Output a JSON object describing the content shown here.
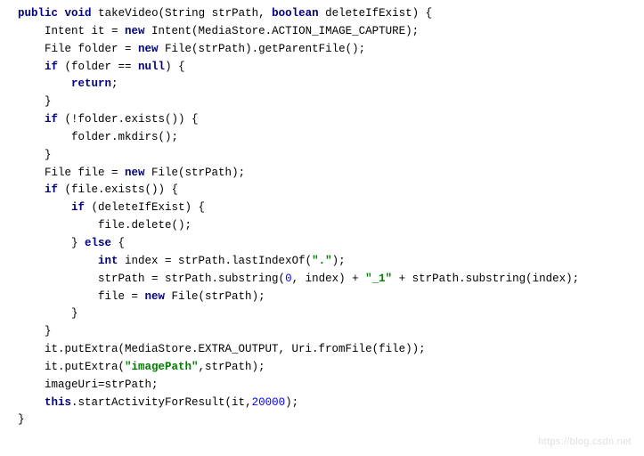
{
  "code": {
    "kw": {
      "public": "public",
      "void": "void",
      "boolean": "boolean",
      "new": "new",
      "if": "if",
      "null": "null",
      "return": "return",
      "else": "else",
      "int": "int",
      "this": "this"
    },
    "id": {
      "takeVideo": "takeVideo",
      "strPath_sig": "(String strPath, ",
      "deleteIfExist_decl": " deleteIfExist) {",
      "l2a": "    Intent it = ",
      "l2b": " Intent(MediaStore.ACTION_IMAGE_CAPTURE);",
      "l3a": "    File folder = ",
      "l3b": " File(strPath).getParentFile();",
      "l4a": "    ",
      "l4b": " (folder == ",
      "l4c": ") {",
      "l5a": "        ",
      "l5b": ";",
      "l6": "    }",
      "l7a": "    ",
      "l7b": " (!folder.exists()) {",
      "l8": "        folder.mkdirs();",
      "l9": "    }",
      "l10a": "    File file = ",
      "l10b": " File(strPath);",
      "l11a": "    ",
      "l11b": " (file.exists()) {",
      "l12a": "        ",
      "l12b": " (deleteIfExist) {",
      "l13": "            file.delete();",
      "l14a": "        } ",
      "l14b": " {",
      "l15a": "            ",
      "l15b": " index = strPath.lastIndexOf(",
      "l15c": ");",
      "l16a": "            strPath = strPath.substring(",
      "l16b": ", index) + ",
      "l16c": " + strPath.substring(index);",
      "l17a": "            file = ",
      "l17b": " File(strPath);",
      "l18": "        }",
      "l19": "    }",
      "l20": "    it.putExtra(MediaStore.EXTRA_OUTPUT, Uri.fromFile(file));",
      "l21a": "    it.putExtra(",
      "l21b": ",strPath);",
      "l22": "    imageUri=strPath;",
      "l23a": "    ",
      "l23b": ".startActivityForResult(it,",
      "l23c": ");",
      "l24": "}"
    },
    "str": {
      "dot": "\".\"",
      "us1": "\"_1\"",
      "imagePath": "\"imagePath\""
    },
    "num": {
      "zero": "0",
      "twentyK": "20000"
    }
  },
  "watermark": "https://blog.csdn.net"
}
